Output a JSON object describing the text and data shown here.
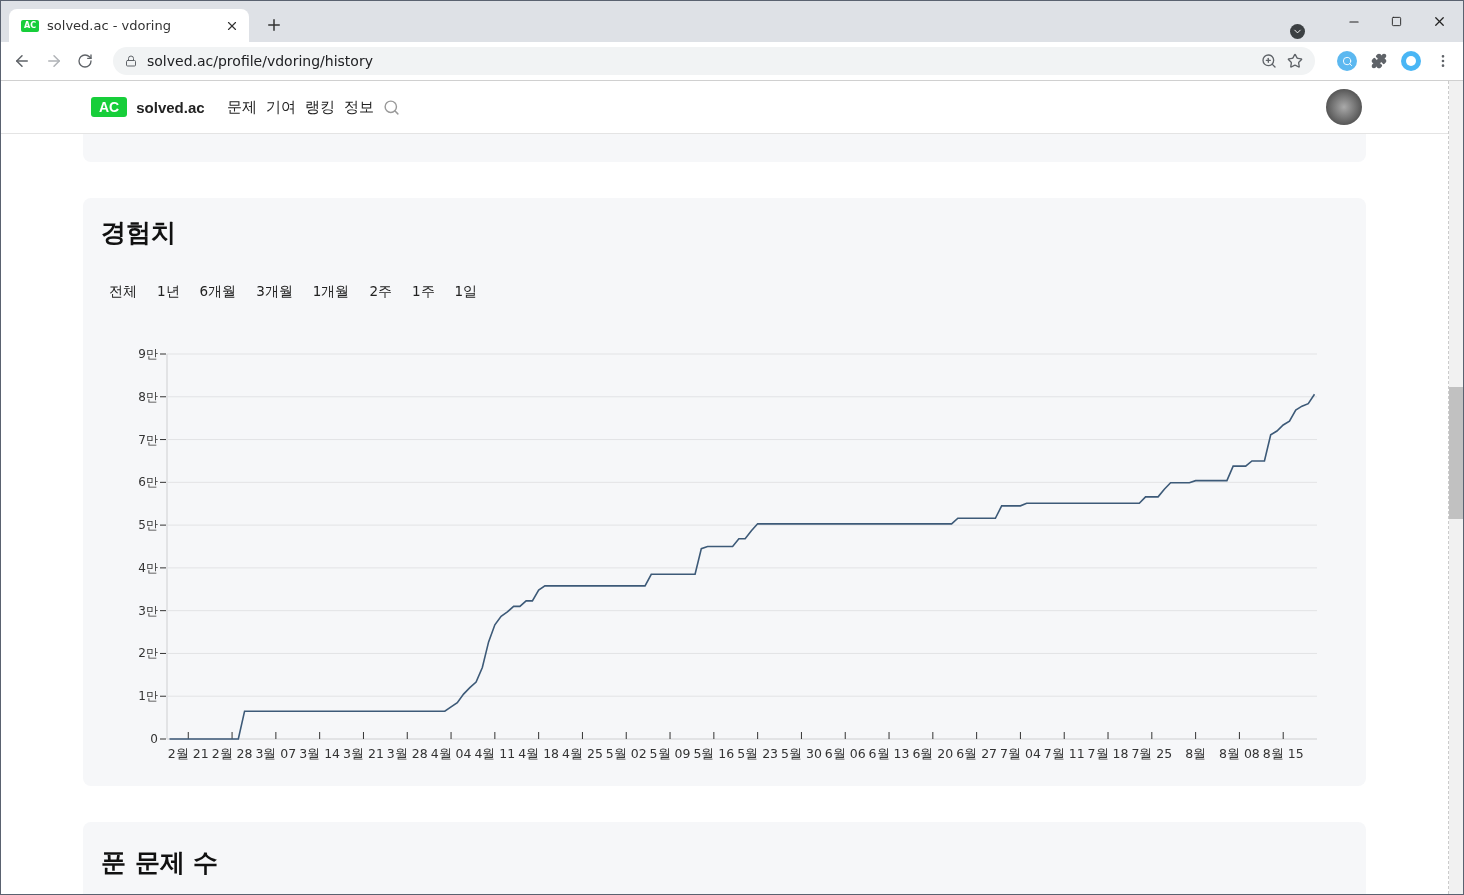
{
  "browser": {
    "tab_title": "solved.ac - vdoring",
    "favicon_text": "AC",
    "url": "solved.ac/profile/vdoring/history"
  },
  "header": {
    "logo_badge": "AC",
    "logo_text": "solved.ac",
    "nav": [
      "문제",
      "기여",
      "랭킹",
      "정보"
    ]
  },
  "experience": {
    "title": "경험치",
    "ranges": [
      "전체",
      "1년",
      "6개월",
      "3개월",
      "1개월",
      "2주",
      "1주",
      "1일"
    ],
    "chart_data": {
      "type": "line",
      "categories": [
        null,
        null,
        null,
        "2월 21",
        null,
        null,
        null,
        null,
        null,
        null,
        "2월 28",
        null,
        null,
        null,
        null,
        null,
        null,
        "3월 07",
        null,
        null,
        null,
        null,
        null,
        null,
        "3월 14",
        null,
        null,
        null,
        null,
        null,
        null,
        "3월 21",
        null,
        null,
        null,
        null,
        null,
        null,
        "3월 28",
        null,
        null,
        null,
        null,
        null,
        null,
        "4월 04",
        null,
        null,
        null,
        null,
        null,
        null,
        "4월 11",
        null,
        null,
        null,
        null,
        null,
        null,
        "4월 18",
        null,
        null,
        null,
        null,
        null,
        null,
        "4월 25",
        null,
        null,
        null,
        null,
        null,
        null,
        "5월 02",
        null,
        null,
        null,
        null,
        null,
        null,
        "5월 09",
        null,
        null,
        null,
        null,
        null,
        null,
        "5월 16",
        null,
        null,
        null,
        null,
        null,
        null,
        "5월 23",
        null,
        null,
        null,
        null,
        null,
        null,
        "5월 30",
        null,
        null,
        null,
        null,
        null,
        null,
        "6월 06",
        null,
        null,
        null,
        null,
        null,
        null,
        "6월 13",
        null,
        null,
        null,
        null,
        null,
        null,
        "6월 20",
        null,
        null,
        null,
        null,
        null,
        null,
        "6월 27",
        null,
        null,
        null,
        null,
        null,
        null,
        "7월 04",
        null,
        null,
        null,
        null,
        null,
        null,
        "7월 11",
        null,
        null,
        null,
        null,
        null,
        null,
        "7월 18",
        null,
        null,
        null,
        null,
        null,
        null,
        "7월 25",
        null,
        null,
        null,
        null,
        null,
        null,
        "8월",
        null,
        null,
        null,
        null,
        null,
        null,
        "8월 08",
        null,
        null,
        null,
        null,
        null,
        null,
        "8월 15",
        null,
        null,
        null,
        null,
        null
      ],
      "series": [
        {
          "color": "#3d5a78",
          "values": [
            0,
            0,
            0,
            0,
            0,
            0,
            0,
            0,
            0,
            0,
            0,
            0,
            0.65,
            0.65,
            0.65,
            0.65,
            0.65,
            0.65,
            0.65,
            0.65,
            0.65,
            0.65,
            0.65,
            0.65,
            0.65,
            0.65,
            0.65,
            0.65,
            0.65,
            0.65,
            0.65,
            0.65,
            0.65,
            0.65,
            0.65,
            0.65,
            0.65,
            0.65,
            0.65,
            0.65,
            0.65,
            0.65,
            0.65,
            0.65,
            0.65,
            0.75,
            0.85,
            1.05,
            1.2,
            1.33,
            1.67,
            2.27,
            2.67,
            2.87,
            2.97,
            3.1,
            3.1,
            3.23,
            3.23,
            3.48,
            3.58,
            3.58,
            3.58,
            3.58,
            3.58,
            3.58,
            3.58,
            3.58,
            3.58,
            3.58,
            3.58,
            3.58,
            3.58,
            3.58,
            3.58,
            3.58,
            3.58,
            3.85,
            3.85,
            3.85,
            3.85,
            3.85,
            3.85,
            3.85,
            3.85,
            4.45,
            4.5,
            4.5,
            4.5,
            4.5,
            4.5,
            4.68,
            4.68,
            4.87,
            5.03,
            5.03,
            5.03,
            5.03,
            5.03,
            5.03,
            5.03,
            5.03,
            5.03,
            5.03,
            5.03,
            5.03,
            5.03,
            5.03,
            5.03,
            5.03,
            5.03,
            5.03,
            5.03,
            5.03,
            5.03,
            5.03,
            5.03,
            5.03,
            5.03,
            5.03,
            5.03,
            5.03,
            5.03,
            5.03,
            5.03,
            5.03,
            5.16,
            5.16,
            5.16,
            5.16,
            5.16,
            5.16,
            5.16,
            5.45,
            5.45,
            5.45,
            5.45,
            5.51,
            5.51,
            5.51,
            5.51,
            5.51,
            5.51,
            5.51,
            5.51,
            5.51,
            5.51,
            5.51,
            5.51,
            5.51,
            5.51,
            5.51,
            5.51,
            5.51,
            5.51,
            5.51,
            5.66,
            5.66,
            5.66,
            5.84,
            5.99,
            5.99,
            5.99,
            5.99,
            6.04,
            6.04,
            6.04,
            6.04,
            6.04,
            6.04,
            6.38,
            6.38,
            6.38,
            6.5,
            6.5,
            6.5,
            7.11,
            7.2,
            7.34,
            7.43,
            7.69,
            7.78,
            7.84,
            8.06
          ]
        }
      ],
      "ylim": [
        0,
        9
      ],
      "grid": true,
      "yticks": [
        {
          "value": 0,
          "label": "0"
        },
        {
          "value": 1,
          "label": "1만"
        },
        {
          "value": 2,
          "label": "2만"
        },
        {
          "value": 3,
          "label": "3만"
        },
        {
          "value": 4,
          "label": "4만"
        },
        {
          "value": 5,
          "label": "5만"
        },
        {
          "value": 6,
          "label": "6만"
        },
        {
          "value": 7,
          "label": "7만"
        },
        {
          "value": 8,
          "label": "8만"
        },
        {
          "value": 9,
          "label": "9만"
        }
      ]
    }
  },
  "solved_count": {
    "title": "푼 문제 수"
  }
}
